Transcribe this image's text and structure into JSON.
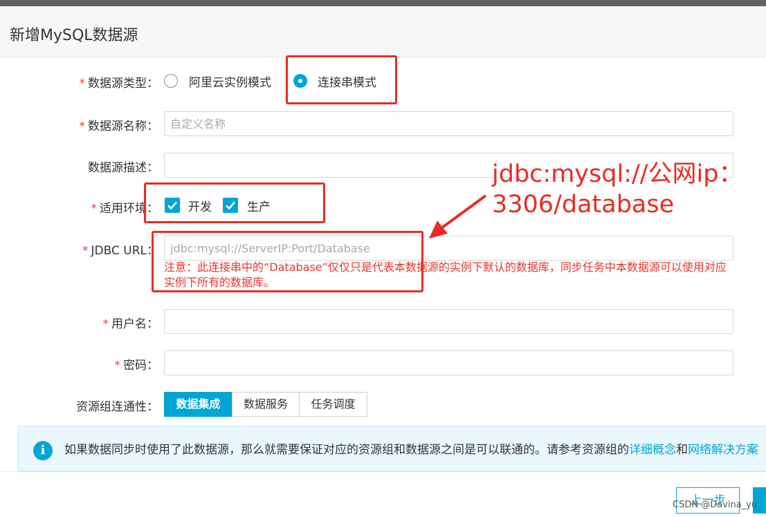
{
  "header": {
    "title": "新增MySQL数据源"
  },
  "form": {
    "type": {
      "label": "数据源类型：",
      "option1": "阿里云实例模式",
      "option2": "连接串模式",
      "selected": "连接串模式"
    },
    "name": {
      "label": "数据源名称：",
      "placeholder": "自定义名称"
    },
    "desc": {
      "label": "数据源描述：",
      "placeholder": ""
    },
    "env": {
      "label": "适用环境：",
      "option1": "开发",
      "option2": "生产",
      "checked": [
        "开发",
        "生产"
      ]
    },
    "jdbc": {
      "label": "JDBC URL：",
      "placeholder": "jdbc:mysql://ServerIP:Port/Database",
      "note": "注意：此连接串中的“Database”仅仅只是代表本数据源的实例下默认的数据库，同步任务中本数据源可以使用对应实例下所有的数据库。"
    },
    "username": {
      "label": "用户名："
    },
    "password": {
      "label": "密码："
    },
    "resource": {
      "label": "资源组连通性：",
      "tabs": [
        "数据集成",
        "数据服务",
        "任务调度"
      ],
      "active": "数据集成"
    }
  },
  "info": {
    "icon": "info-icon",
    "text": "如果数据同步时使用了此数据源，那么就需要保证对应的资源组和数据源之间是可以联通的。请参考资源组的",
    "link1": "详细概念",
    "and": "和",
    "link2": "网络解决方案"
  },
  "annotation": {
    "line1": "jdbc:mysql://公网ip：",
    "line2": "3306/database"
  },
  "footer": {
    "prev": "上一步",
    "watermark": "CSDN @Davina_yu"
  },
  "colors": {
    "accent": "#00a6d6",
    "required": "#f04134",
    "annotation": "#ea2b21"
  }
}
